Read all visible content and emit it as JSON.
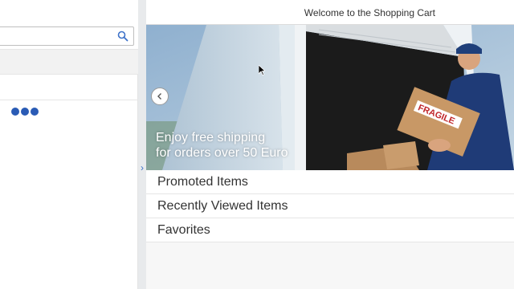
{
  "master": {
    "search": {
      "placeholder": "",
      "value": ""
    }
  },
  "header": {
    "title": "Welcome to the Shopping Cart"
  },
  "carousel": {
    "caption_line1": "Enjoy free shipping",
    "caption_line2": "for orders over 50 Euro",
    "box_label": "FRAGILE"
  },
  "categories": [
    {
      "label": "Promoted Items"
    },
    {
      "label": "Recently Viewed Items"
    },
    {
      "label": "Favorites"
    }
  ],
  "colors": {
    "accent": "#2a5bb5",
    "header_bg": "#ffffff",
    "page_bg": "#f7f7f7"
  }
}
